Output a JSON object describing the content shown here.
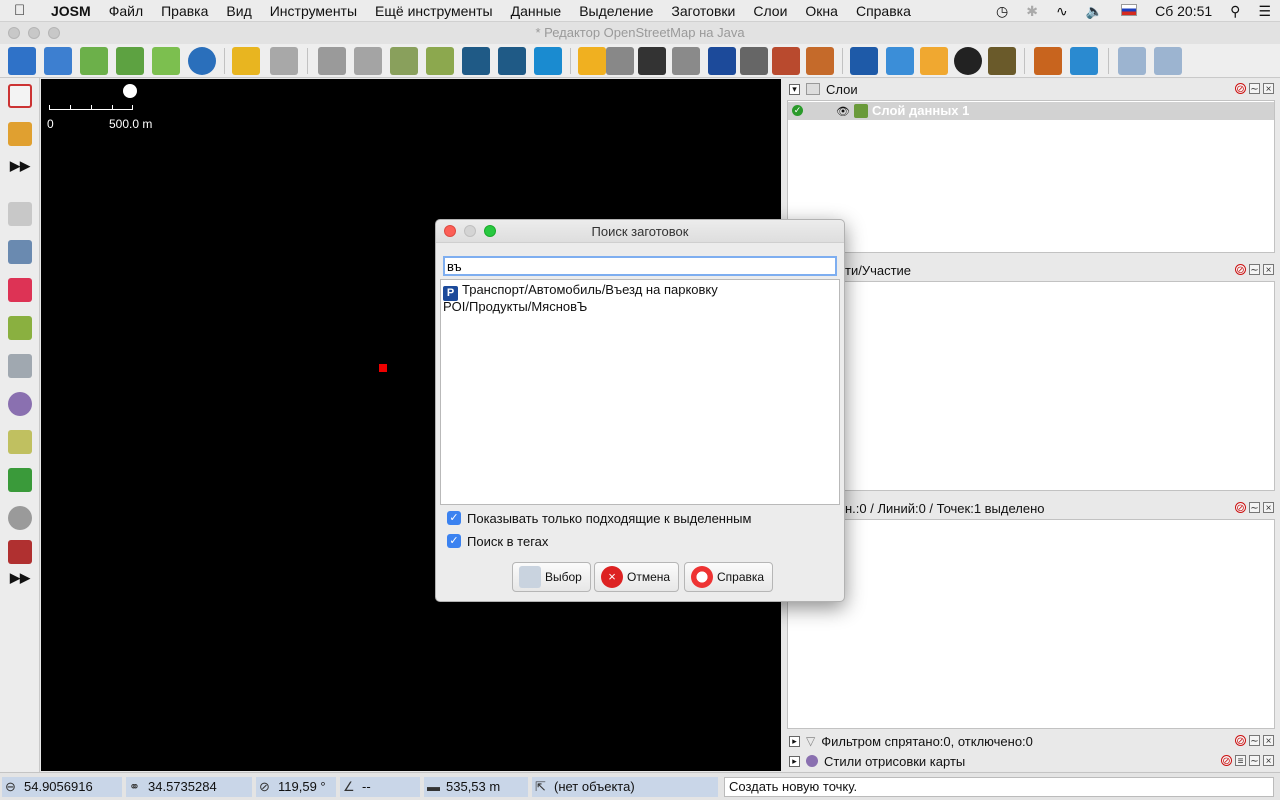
{
  "menubar": {
    "app_name": "JOSM",
    "items": [
      "Файл",
      "Правка",
      "Вид",
      "Инструменты",
      "Ещё инструменты",
      "Данные",
      "Выделение",
      "Заготовки",
      "Слои",
      "Окна",
      "Справка"
    ],
    "clock": "Сб 20:51"
  },
  "window": {
    "title": "* Редактор OpenStreetMap на Java"
  },
  "map": {
    "scale_start": "0",
    "scale_end": "500.0 m"
  },
  "panels": {
    "layers": {
      "title": "Слои",
      "layer_name": "Слой данных 1"
    },
    "relations": {
      "title": "ти/Участие"
    },
    "selection": {
      "title": "н.:0 / Линий:0 / Точек:1 выделено"
    },
    "filter": {
      "title": "Фильтром спрятано:0, отключено:0"
    },
    "styles": {
      "title": "Стили отрисовки карты"
    }
  },
  "statusbar": {
    "lat": "54.9056916",
    "lon": "34.5735284",
    "heading": "119,59 °",
    "angle": "--",
    "distance": "535,53 m",
    "object": "(нет объекта)",
    "message": "Создать новую точку."
  },
  "dialog": {
    "title": "Поиск заготовок",
    "search_value": "въ",
    "results": [
      {
        "icon": "P",
        "label": "Транспорт/Автомобиль/Въезд на парковку"
      },
      {
        "icon": "",
        "label": "POI/Продукты/МясновЪ"
      }
    ],
    "check_only_matching": "Показывать только подходящие к выделенным",
    "check_search_tags": "Поиск в тегах",
    "btn_select": "Выбор",
    "btn_cancel": "Отмена",
    "btn_help": "Справка"
  },
  "colors": {
    "map_bg": "#000000",
    "accent": "#3b82f0",
    "node": "#ee0000",
    "status_field": "#c9d6e8"
  }
}
